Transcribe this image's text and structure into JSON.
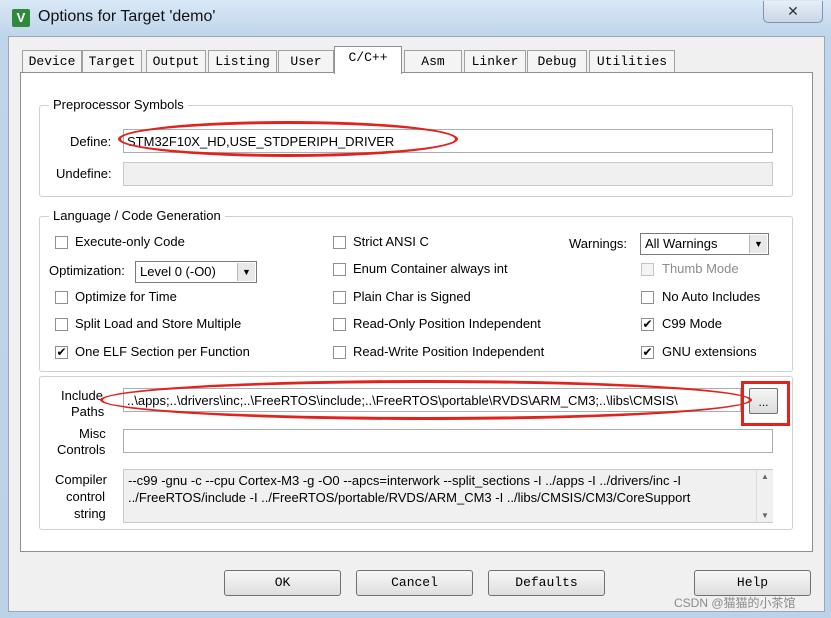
{
  "window": {
    "title": "Options for Target 'demo'",
    "close_label": "✕",
    "icon_glyph": "V"
  },
  "tabs": [
    {
      "label": "Device"
    },
    {
      "label": "Target"
    },
    {
      "label": "Output"
    },
    {
      "label": "Listing"
    },
    {
      "label": "User"
    },
    {
      "label": "C/C++"
    },
    {
      "label": "Asm"
    },
    {
      "label": "Linker"
    },
    {
      "label": "Debug"
    },
    {
      "label": "Utilities"
    }
  ],
  "preprocessor": {
    "group_title": "Preprocessor Symbols",
    "define_label": "Define:",
    "define_value": "STM32F10X_HD,USE_STDPERIPH_DRIVER",
    "undefine_label": "Undefine:",
    "undefine_value": ""
  },
  "codegen": {
    "group_title": "Language / Code Generation",
    "execute_only": {
      "label": "Execute-only Code",
      "mark": ""
    },
    "optimization_label": "Optimization:",
    "optimization_value": "Level 0 (-O0)",
    "optimize_time": {
      "label": "Optimize for Time",
      "mark": ""
    },
    "split_load": {
      "label": "Split Load and Store Multiple",
      "mark": ""
    },
    "one_elf": {
      "label": "One ELF Section per Function",
      "mark": "✔"
    },
    "strict_ansi": {
      "label": "Strict ANSI C",
      "mark": ""
    },
    "enum_container": {
      "label": "Enum Container always int",
      "mark": ""
    },
    "plain_char": {
      "label": "Plain Char is Signed",
      "mark": ""
    },
    "ro_pos": {
      "label": "Read-Only Position Independent",
      "mark": ""
    },
    "rw_pos": {
      "label": "Read-Write Position Independent",
      "mark": ""
    },
    "warnings_label": "Warnings:",
    "warnings_value": "All Warnings",
    "thumb_mode": {
      "label": "Thumb Mode",
      "mark": ""
    },
    "no_auto_includes": {
      "label": "No Auto Includes",
      "mark": ""
    },
    "c99_mode": {
      "label": "C99 Mode",
      "mark": "✔"
    },
    "gnu_ext": {
      "label": "GNU extensions",
      "mark": "✔"
    },
    "dropdown_arrow": "▼"
  },
  "paths": {
    "include_label_1": "Include",
    "include_label_2": "Paths",
    "include_value": "..\\apps;..\\drivers\\inc;..\\FreeRTOS\\include;..\\FreeRTOS\\portable\\RVDS\\ARM_CM3;..\\libs\\CMSIS\\",
    "browse_label": "...",
    "misc_label_1": "Misc",
    "misc_label_2": "Controls",
    "misc_value": "",
    "compiler_label_1": "Compiler",
    "compiler_label_2": "control",
    "compiler_label_3": "string",
    "compiler_line_1": "--c99 -gnu -c --cpu Cortex-M3 -g -O0 --apcs=interwork --split_sections -I ../apps -I ../drivers/inc -I",
    "compiler_line_2": "../FreeRTOS/include -I ../FreeRTOS/portable/RVDS/ARM_CM3 -I ../libs/CMSIS/CM3/CoreSupport",
    "scroll_up": "▲",
    "scroll_down": "▼"
  },
  "buttons": {
    "ok": "OK",
    "cancel": "Cancel",
    "defaults": "Defaults",
    "help": "Help"
  },
  "watermark": "CSDN @猫猫的小茶馆"
}
